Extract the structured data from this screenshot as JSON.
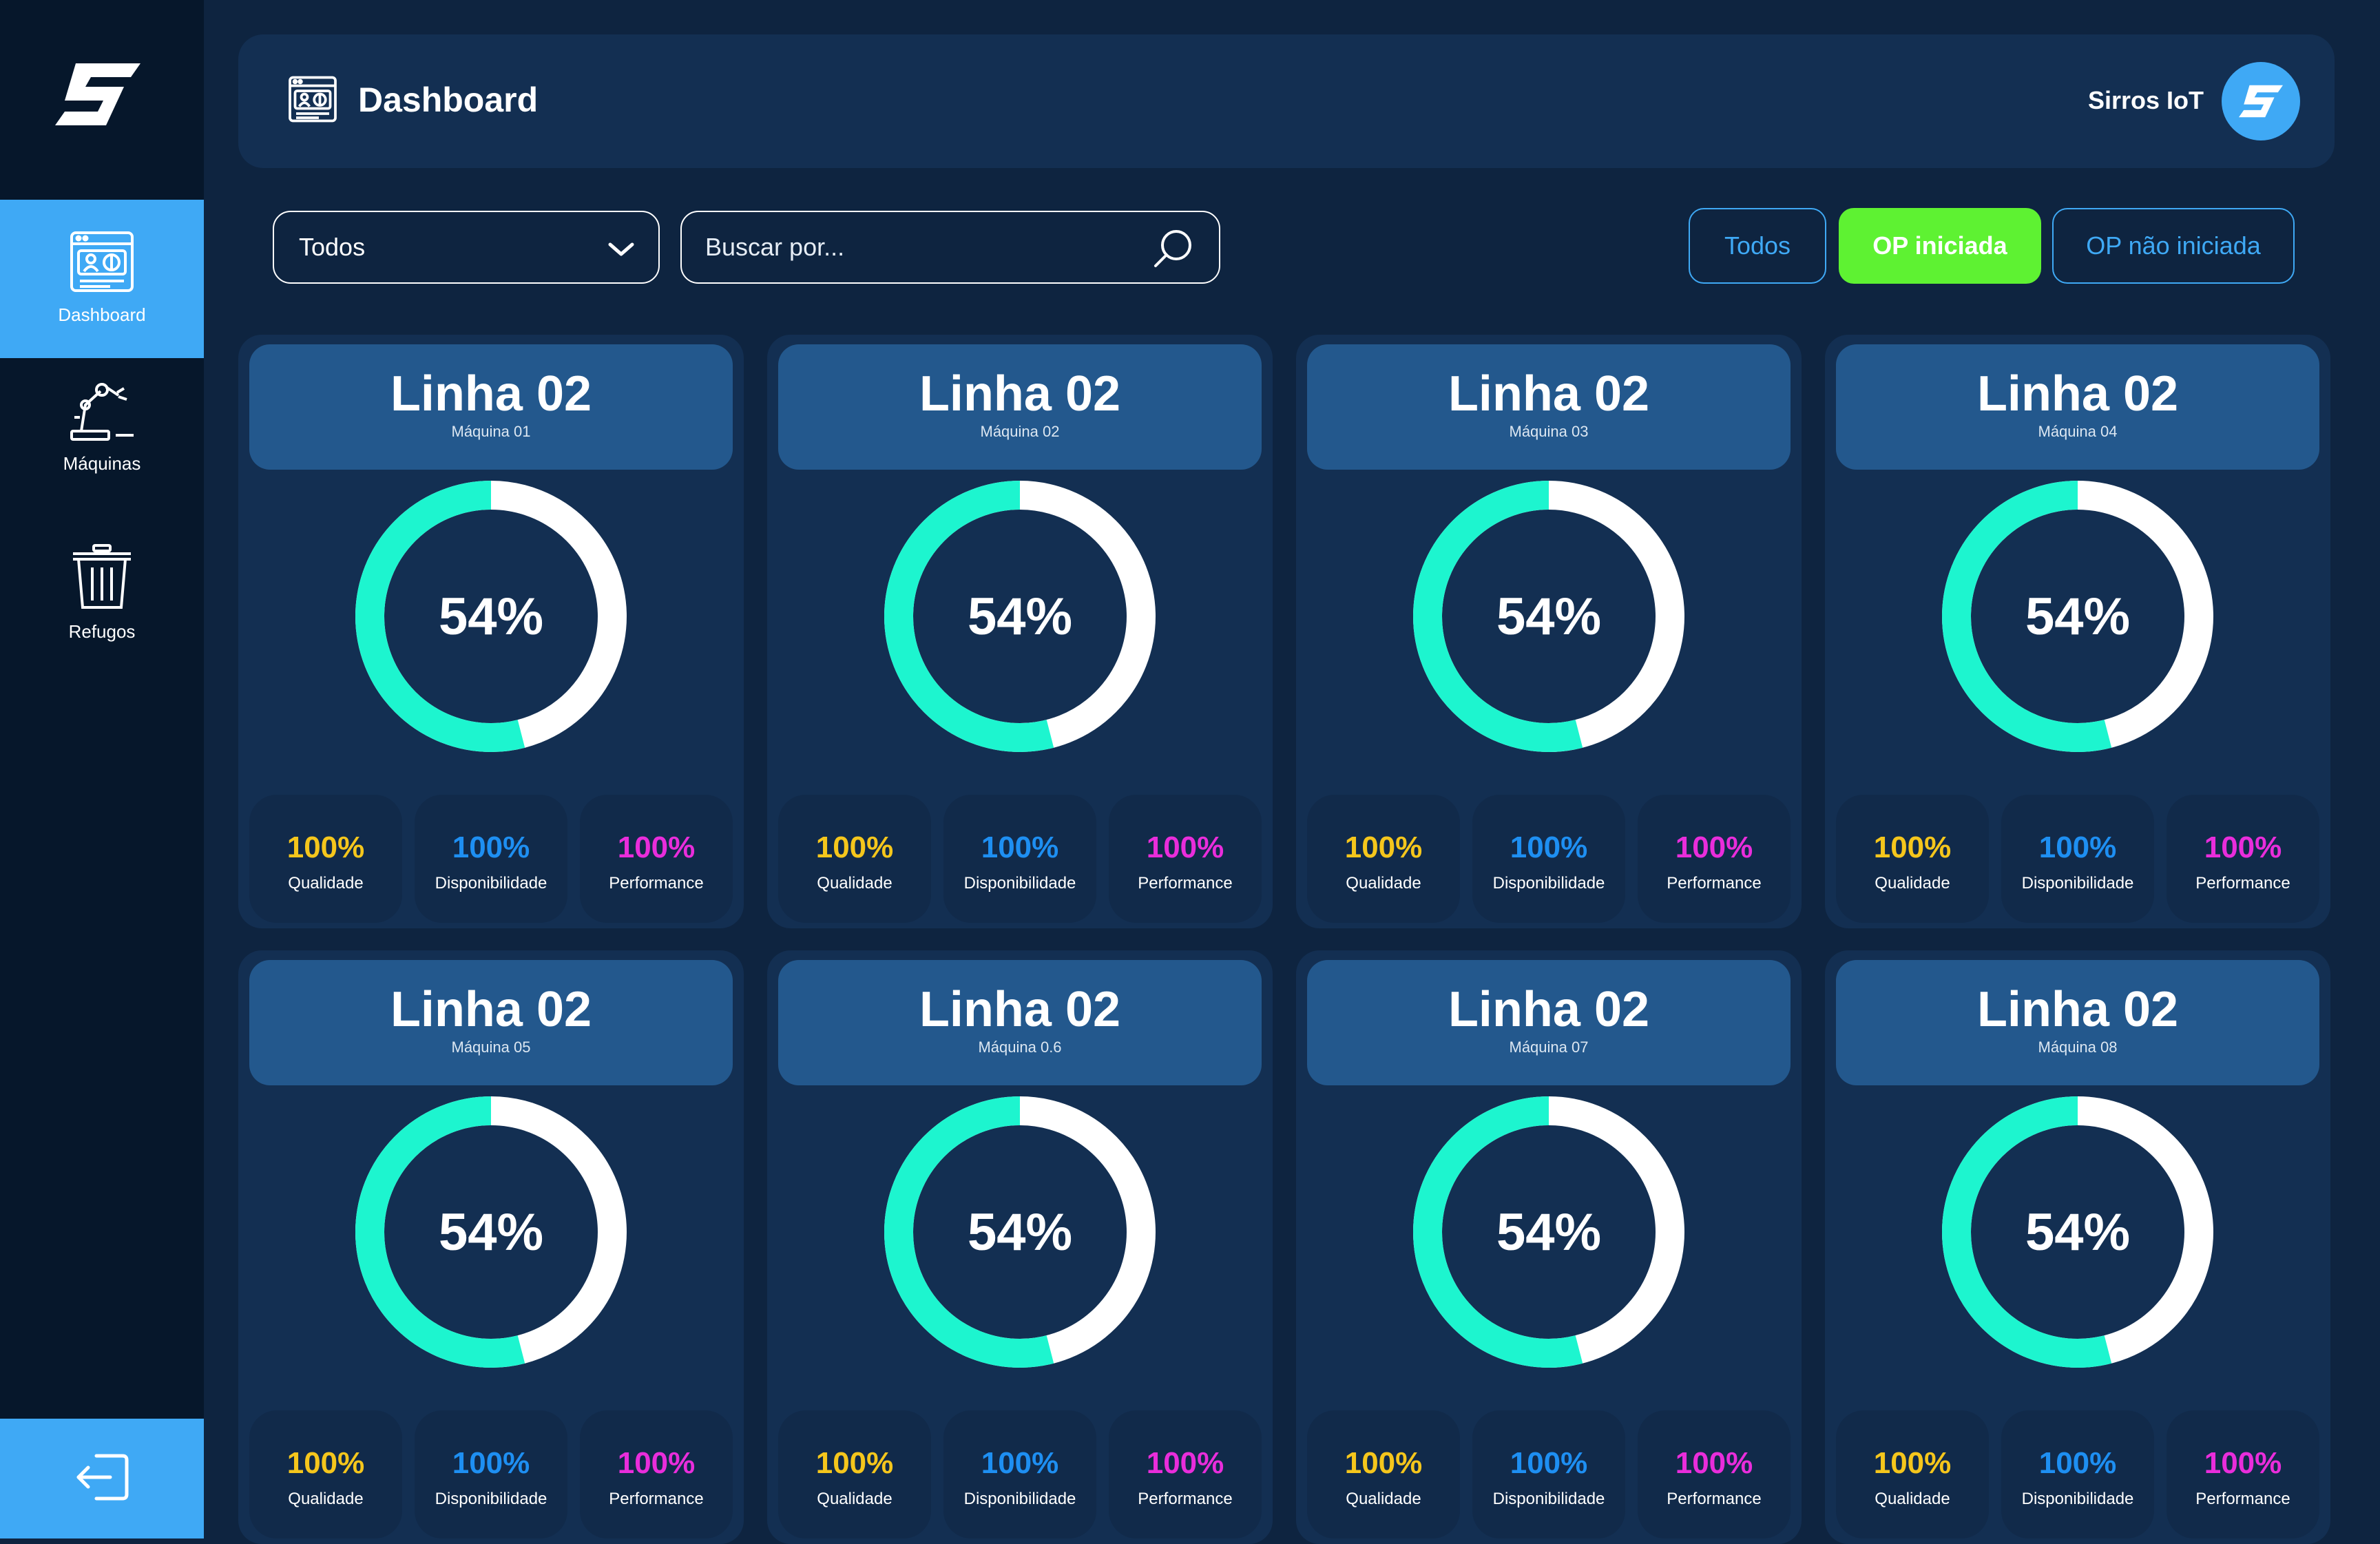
{
  "app": {
    "user_name": "Sirros IoT"
  },
  "header": {
    "title": "Dashboard"
  },
  "sidebar": {
    "items": [
      {
        "label": "Dashboard",
        "icon": "dashboard-icon",
        "active": true
      },
      {
        "label": "Máquinas",
        "icon": "robot-arm-icon",
        "active": false
      },
      {
        "label": "Refugos",
        "icon": "trash-icon",
        "active": false
      }
    ],
    "logout_icon": "logout-icon"
  },
  "filters": {
    "select_value": "Todos",
    "search_placeholder": "Buscar por...",
    "status_pills": [
      {
        "label": "Todos",
        "active": false
      },
      {
        "label": "OP iniciada",
        "active": true
      },
      {
        "label": "OP não iniciada",
        "active": false
      }
    ]
  },
  "colors": {
    "accent": "#3fa9f5",
    "active_pill": "#5ef232",
    "gauge_fill": "#1df5cf",
    "gauge_track": "#ffffff",
    "qualidade": "#f5c61c",
    "disponibilidade": "#1e8ff2",
    "performance": "#e92ddb"
  },
  "cards": [
    {
      "title": "Linha 02",
      "machine": "Máquina 01",
      "oee_value": 54,
      "oee_label": "54%",
      "metrics": [
        {
          "value": "100%",
          "label": "Qualidade"
        },
        {
          "value": "100%",
          "label": "Disponibilidade"
        },
        {
          "value": "100%",
          "label": "Performance"
        }
      ]
    },
    {
      "title": "Linha 02",
      "machine": "Máquina 02",
      "oee_value": 54,
      "oee_label": "54%",
      "metrics": [
        {
          "value": "100%",
          "label": "Qualidade"
        },
        {
          "value": "100%",
          "label": "Disponibilidade"
        },
        {
          "value": "100%",
          "label": "Performance"
        }
      ]
    },
    {
      "title": "Linha 02",
      "machine": "Máquina 03",
      "oee_value": 54,
      "oee_label": "54%",
      "metrics": [
        {
          "value": "100%",
          "label": "Qualidade"
        },
        {
          "value": "100%",
          "label": "Disponibilidade"
        },
        {
          "value": "100%",
          "label": "Performance"
        }
      ]
    },
    {
      "title": "Linha 02",
      "machine": "Máquina 04",
      "oee_value": 54,
      "oee_label": "54%",
      "metrics": [
        {
          "value": "100%",
          "label": "Qualidade"
        },
        {
          "value": "100%",
          "label": "Disponibilidade"
        },
        {
          "value": "100%",
          "label": "Performance"
        }
      ]
    },
    {
      "title": "Linha 02",
      "machine": "Máquina 05",
      "oee_value": 54,
      "oee_label": "54%",
      "metrics": [
        {
          "value": "100%",
          "label": "Qualidade"
        },
        {
          "value": "100%",
          "label": "Disponibilidade"
        },
        {
          "value": "100%",
          "label": "Performance"
        }
      ]
    },
    {
      "title": "Linha 02",
      "machine": "Máquina 0.6",
      "oee_value": 54,
      "oee_label": "54%",
      "metrics": [
        {
          "value": "100%",
          "label": "Qualidade"
        },
        {
          "value": "100%",
          "label": "Disponibilidade"
        },
        {
          "value": "100%",
          "label": "Performance"
        }
      ]
    },
    {
      "title": "Linha 02",
      "machine": "Máquina 07",
      "oee_value": 54,
      "oee_label": "54%",
      "metrics": [
        {
          "value": "100%",
          "label": "Qualidade"
        },
        {
          "value": "100%",
          "label": "Disponibilidade"
        },
        {
          "value": "100%",
          "label": "Performance"
        }
      ]
    },
    {
      "title": "Linha 02",
      "machine": "Máquina 08",
      "oee_value": 54,
      "oee_label": "54%",
      "metrics": [
        {
          "value": "100%",
          "label": "Qualidade"
        },
        {
          "value": "100%",
          "label": "Disponibilidade"
        },
        {
          "value": "100%",
          "label": "Performance"
        }
      ]
    }
  ]
}
